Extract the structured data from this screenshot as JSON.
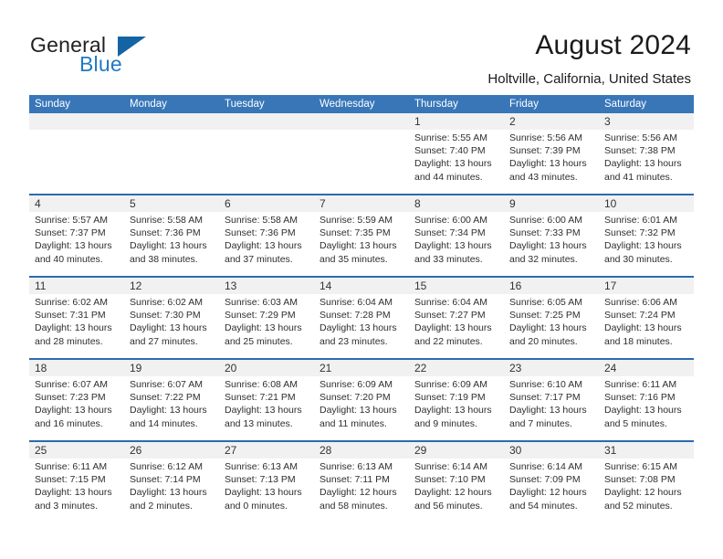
{
  "brand": {
    "word_general": "General",
    "word_blue": "Blue",
    "triangle_color": "#1464a5"
  },
  "header": {
    "title": "August 2024",
    "subtitle": "Holtville, California, United States"
  },
  "theme": {
    "header_blue": "#3876b8",
    "rule_blue": "#2a6bb0",
    "num_band_gray": "#f1f1f1"
  },
  "calendar": {
    "weekdays": [
      "Sunday",
      "Monday",
      "Tuesday",
      "Wednesday",
      "Thursday",
      "Friday",
      "Saturday"
    ],
    "weeks": [
      [
        {
          "day": "",
          "sunrise": "",
          "sunset": "",
          "daylight1": "",
          "daylight2": ""
        },
        {
          "day": "",
          "sunrise": "",
          "sunset": "",
          "daylight1": "",
          "daylight2": ""
        },
        {
          "day": "",
          "sunrise": "",
          "sunset": "",
          "daylight1": "",
          "daylight2": ""
        },
        {
          "day": "",
          "sunrise": "",
          "sunset": "",
          "daylight1": "",
          "daylight2": ""
        },
        {
          "day": "1",
          "sunrise": "Sunrise: 5:55 AM",
          "sunset": "Sunset: 7:40 PM",
          "daylight1": "Daylight: 13 hours",
          "daylight2": "and 44 minutes."
        },
        {
          "day": "2",
          "sunrise": "Sunrise: 5:56 AM",
          "sunset": "Sunset: 7:39 PM",
          "daylight1": "Daylight: 13 hours",
          "daylight2": "and 43 minutes."
        },
        {
          "day": "3",
          "sunrise": "Sunrise: 5:56 AM",
          "sunset": "Sunset: 7:38 PM",
          "daylight1": "Daylight: 13 hours",
          "daylight2": "and 41 minutes."
        }
      ],
      [
        {
          "day": "4",
          "sunrise": "Sunrise: 5:57 AM",
          "sunset": "Sunset: 7:37 PM",
          "daylight1": "Daylight: 13 hours",
          "daylight2": "and 40 minutes."
        },
        {
          "day": "5",
          "sunrise": "Sunrise: 5:58 AM",
          "sunset": "Sunset: 7:36 PM",
          "daylight1": "Daylight: 13 hours",
          "daylight2": "and 38 minutes."
        },
        {
          "day": "6",
          "sunrise": "Sunrise: 5:58 AM",
          "sunset": "Sunset: 7:36 PM",
          "daylight1": "Daylight: 13 hours",
          "daylight2": "and 37 minutes."
        },
        {
          "day": "7",
          "sunrise": "Sunrise: 5:59 AM",
          "sunset": "Sunset: 7:35 PM",
          "daylight1": "Daylight: 13 hours",
          "daylight2": "and 35 minutes."
        },
        {
          "day": "8",
          "sunrise": "Sunrise: 6:00 AM",
          "sunset": "Sunset: 7:34 PM",
          "daylight1": "Daylight: 13 hours",
          "daylight2": "and 33 minutes."
        },
        {
          "day": "9",
          "sunrise": "Sunrise: 6:00 AM",
          "sunset": "Sunset: 7:33 PM",
          "daylight1": "Daylight: 13 hours",
          "daylight2": "and 32 minutes."
        },
        {
          "day": "10",
          "sunrise": "Sunrise: 6:01 AM",
          "sunset": "Sunset: 7:32 PM",
          "daylight1": "Daylight: 13 hours",
          "daylight2": "and 30 minutes."
        }
      ],
      [
        {
          "day": "11",
          "sunrise": "Sunrise: 6:02 AM",
          "sunset": "Sunset: 7:31 PM",
          "daylight1": "Daylight: 13 hours",
          "daylight2": "and 28 minutes."
        },
        {
          "day": "12",
          "sunrise": "Sunrise: 6:02 AM",
          "sunset": "Sunset: 7:30 PM",
          "daylight1": "Daylight: 13 hours",
          "daylight2": "and 27 minutes."
        },
        {
          "day": "13",
          "sunrise": "Sunrise: 6:03 AM",
          "sunset": "Sunset: 7:29 PM",
          "daylight1": "Daylight: 13 hours",
          "daylight2": "and 25 minutes."
        },
        {
          "day": "14",
          "sunrise": "Sunrise: 6:04 AM",
          "sunset": "Sunset: 7:28 PM",
          "daylight1": "Daylight: 13 hours",
          "daylight2": "and 23 minutes."
        },
        {
          "day": "15",
          "sunrise": "Sunrise: 6:04 AM",
          "sunset": "Sunset: 7:27 PM",
          "daylight1": "Daylight: 13 hours",
          "daylight2": "and 22 minutes."
        },
        {
          "day": "16",
          "sunrise": "Sunrise: 6:05 AM",
          "sunset": "Sunset: 7:25 PM",
          "daylight1": "Daylight: 13 hours",
          "daylight2": "and 20 minutes."
        },
        {
          "day": "17",
          "sunrise": "Sunrise: 6:06 AM",
          "sunset": "Sunset: 7:24 PM",
          "daylight1": "Daylight: 13 hours",
          "daylight2": "and 18 minutes."
        }
      ],
      [
        {
          "day": "18",
          "sunrise": "Sunrise: 6:07 AM",
          "sunset": "Sunset: 7:23 PM",
          "daylight1": "Daylight: 13 hours",
          "daylight2": "and 16 minutes."
        },
        {
          "day": "19",
          "sunrise": "Sunrise: 6:07 AM",
          "sunset": "Sunset: 7:22 PM",
          "daylight1": "Daylight: 13 hours",
          "daylight2": "and 14 minutes."
        },
        {
          "day": "20",
          "sunrise": "Sunrise: 6:08 AM",
          "sunset": "Sunset: 7:21 PM",
          "daylight1": "Daylight: 13 hours",
          "daylight2": "and 13 minutes."
        },
        {
          "day": "21",
          "sunrise": "Sunrise: 6:09 AM",
          "sunset": "Sunset: 7:20 PM",
          "daylight1": "Daylight: 13 hours",
          "daylight2": "and 11 minutes."
        },
        {
          "day": "22",
          "sunrise": "Sunrise: 6:09 AM",
          "sunset": "Sunset: 7:19 PM",
          "daylight1": "Daylight: 13 hours",
          "daylight2": "and 9 minutes."
        },
        {
          "day": "23",
          "sunrise": "Sunrise: 6:10 AM",
          "sunset": "Sunset: 7:17 PM",
          "daylight1": "Daylight: 13 hours",
          "daylight2": "and 7 minutes."
        },
        {
          "day": "24",
          "sunrise": "Sunrise: 6:11 AM",
          "sunset": "Sunset: 7:16 PM",
          "daylight1": "Daylight: 13 hours",
          "daylight2": "and 5 minutes."
        }
      ],
      [
        {
          "day": "25",
          "sunrise": "Sunrise: 6:11 AM",
          "sunset": "Sunset: 7:15 PM",
          "daylight1": "Daylight: 13 hours",
          "daylight2": "and 3 minutes."
        },
        {
          "day": "26",
          "sunrise": "Sunrise: 6:12 AM",
          "sunset": "Sunset: 7:14 PM",
          "daylight1": "Daylight: 13 hours",
          "daylight2": "and 2 minutes."
        },
        {
          "day": "27",
          "sunrise": "Sunrise: 6:13 AM",
          "sunset": "Sunset: 7:13 PM",
          "daylight1": "Daylight: 13 hours",
          "daylight2": "and 0 minutes."
        },
        {
          "day": "28",
          "sunrise": "Sunrise: 6:13 AM",
          "sunset": "Sunset: 7:11 PM",
          "daylight1": "Daylight: 12 hours",
          "daylight2": "and 58 minutes."
        },
        {
          "day": "29",
          "sunrise": "Sunrise: 6:14 AM",
          "sunset": "Sunset: 7:10 PM",
          "daylight1": "Daylight: 12 hours",
          "daylight2": "and 56 minutes."
        },
        {
          "day": "30",
          "sunrise": "Sunrise: 6:14 AM",
          "sunset": "Sunset: 7:09 PM",
          "daylight1": "Daylight: 12 hours",
          "daylight2": "and 54 minutes."
        },
        {
          "day": "31",
          "sunrise": "Sunrise: 6:15 AM",
          "sunset": "Sunset: 7:08 PM",
          "daylight1": "Daylight: 12 hours",
          "daylight2": "and 52 minutes."
        }
      ]
    ]
  }
}
